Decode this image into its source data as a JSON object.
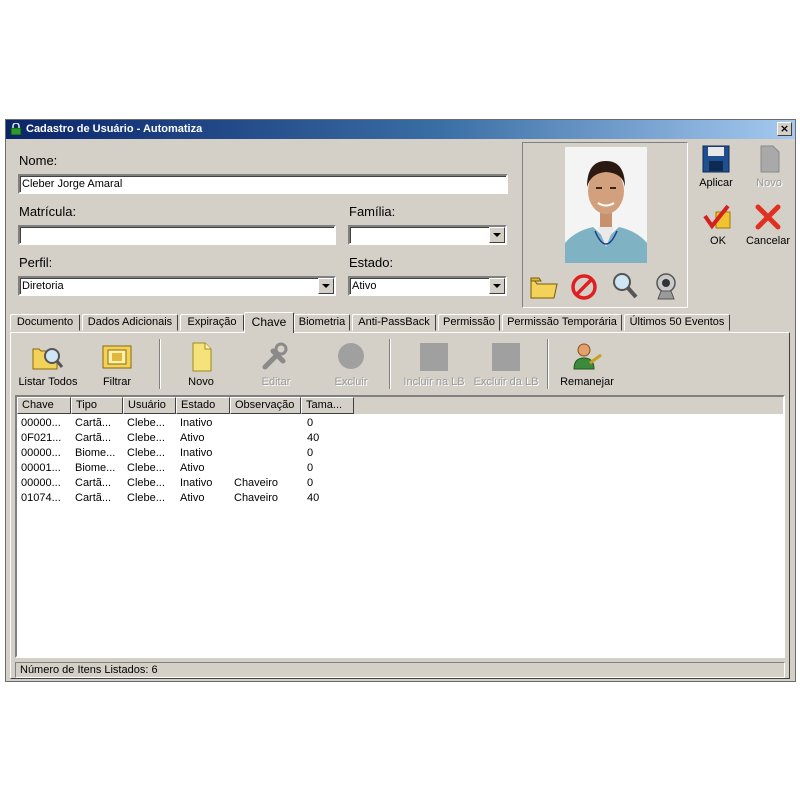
{
  "window": {
    "title": "Cadastro de Usuário  -  Automatiza",
    "close_label": "×"
  },
  "form": {
    "nome_label": "Nome:",
    "nome_value": "Cleber Jorge Amaral",
    "matricula_label": "Matrícula:",
    "matricula_value": "",
    "familia_label": "Família:",
    "familia_value": "",
    "perfil_label": "Perfil:",
    "perfil_value": "Diretoria",
    "estado_label": "Estado:",
    "estado_value": "Ativo"
  },
  "actions": {
    "aplicar": "Aplicar",
    "novo": "Novo",
    "ok": "OK",
    "cancelar": "Cancelar"
  },
  "tabs": [
    "Documento",
    "Dados Adicionais",
    "Expiração",
    "Chave",
    "Biometria",
    "Anti-PassBack",
    "Permissão",
    "Permissão Temporária",
    "Últimos 50 Eventos"
  ],
  "active_tab": "Chave",
  "toolbar": {
    "listar_todos": "Listar Todos",
    "filtrar": "Filtrar",
    "novo": "Novo",
    "editar": "Editar",
    "excluir": "Excluir",
    "incluir_lb": "Incluir na LB",
    "excluir_lb": "Excluir da LB",
    "remanejar": "Remanejar"
  },
  "table": {
    "columns": [
      "Chave",
      "Tipo",
      "Usuário",
      "Estado",
      "Observação",
      "Tama..."
    ],
    "rows": [
      [
        "00000...",
        "Cartã...",
        "Clebe...",
        "Inativo",
        "",
        "0"
      ],
      [
        "0F021...",
        "Cartã...",
        "Clebe...",
        "Ativo",
        "",
        "40"
      ],
      [
        "00000...",
        "Biome...",
        "Clebe...",
        "Inativo",
        "",
        "0"
      ],
      [
        "00001...",
        "Biome...",
        "Clebe...",
        "Ativo",
        "",
        "0"
      ],
      [
        "00000...",
        "Cartã...",
        "Clebe...",
        "Inativo",
        "Chaveiro",
        "0"
      ],
      [
        "01074...",
        "Cartã...",
        "Clebe...",
        "Ativo",
        "Chaveiro",
        "40"
      ]
    ]
  },
  "status": {
    "text": "Número de Itens Listados:  6"
  },
  "colors": {
    "titlebar_start": "#0a246a",
    "titlebar_end": "#a6caf0",
    "face": "#d4d0c8"
  }
}
